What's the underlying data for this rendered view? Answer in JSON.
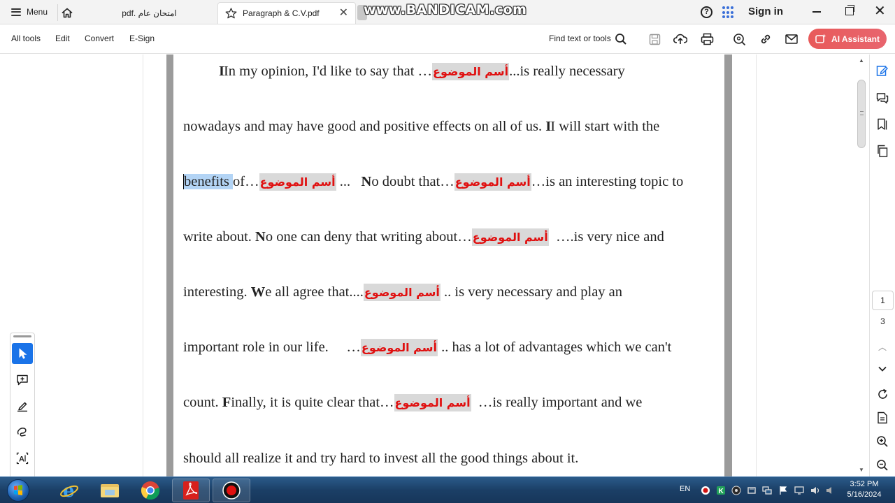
{
  "tabbar": {
    "menu_label": "Menu",
    "tabs": [
      {
        "label": "امتحان عام .pdf"
      },
      {
        "label": "Paragraph & C.V.pdf"
      }
    ],
    "watermark": "www.BANDICAM.com",
    "sign_in": "Sign in"
  },
  "toolbar": {
    "items": [
      "All tools",
      "Edit",
      "Convert",
      "E-Sign"
    ],
    "find_label": "Find text or tools",
    "ai_label": "AI Assistant",
    "accent_color": "#e85a5a"
  },
  "document": {
    "topic": "أسم الموضوع",
    "lines": [
      {
        "pre": "In my opinion, I'd like to say that …",
        "post": "...is really necessary"
      },
      {
        "text_a": "nowadays and may have good and positive effects on all of us. ",
        "text_b": "I will start with the"
      },
      {
        "sel": "benefits ",
        "pre": "of…",
        "mid": " ...   ",
        "n": "N",
        "mid2": "o doubt that…",
        "post": "…is an interesting topic to"
      },
      {
        "pre": "write about. ",
        "n": "N",
        "mid": "o one can deny that writing about…",
        "post": "  ….is very nice and"
      },
      {
        "pre": "interesting. ",
        "w": "W",
        "mid": "e all agree that....",
        "post": " .. is very necessary and play an"
      },
      {
        "pre": "important role in our life.     …",
        "post": " .. has a lot of advantages which we can't"
      },
      {
        "pre": "count. ",
        "f": "F",
        "mid": "inally, it is quite clear that…",
        "post": "  …is really important and we"
      },
      {
        "text": "should all realize it and try hard to invest all the good things about it."
      }
    ]
  },
  "rightbar": {
    "current_page": "1",
    "total_pages": "3"
  },
  "taskbar": {
    "language": "EN",
    "time": "3:52 PM",
    "date": "5/16/2024"
  }
}
